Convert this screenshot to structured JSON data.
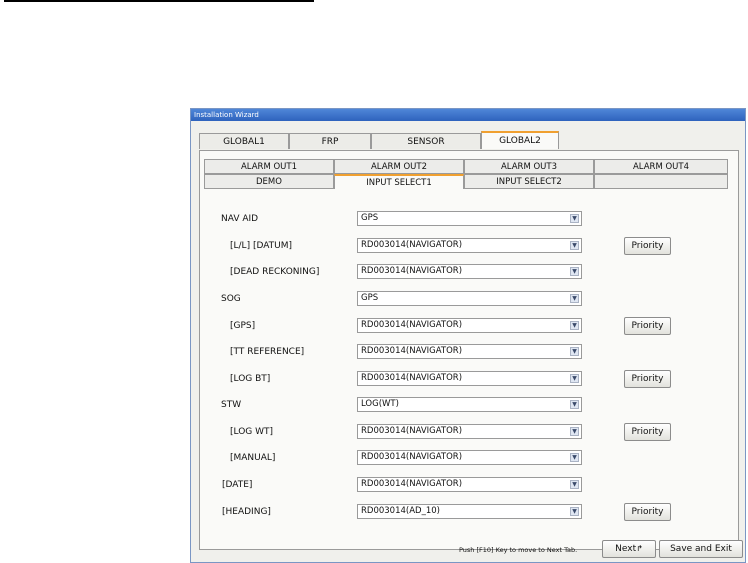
{
  "window": {
    "title": "Installation Wizard"
  },
  "global_tabs": [
    {
      "label": "GLOBAL1",
      "active": false
    },
    {
      "label": "FRP",
      "active": false
    },
    {
      "label": "SENSOR",
      "active": false
    },
    {
      "label": "GLOBAL2",
      "active": true
    }
  ],
  "sub_tabs_row1": [
    {
      "label": "ALARM OUT1",
      "active": false
    },
    {
      "label": "ALARM OUT2",
      "active": false
    },
    {
      "label": "ALARM OUT3",
      "active": false
    },
    {
      "label": "ALARM OUT4",
      "active": false
    }
  ],
  "sub_tabs_row2": [
    {
      "label": "DEMO",
      "active": false
    },
    {
      "label": "INPUT SELECT1",
      "active": true
    },
    {
      "label": "INPUT SELECT2",
      "active": false
    },
    {
      "label": "",
      "active": false
    }
  ],
  "rows": [
    {
      "label": "NAV AID",
      "value": "GPS",
      "priority": false
    },
    {
      "label": "[L/L] [DATUM]",
      "value": "RD003014(NAVIGATOR)",
      "priority": true
    },
    {
      "label": "[DEAD RECKONING]",
      "value": "RD003014(NAVIGATOR)",
      "priority": false
    },
    {
      "label": "SOG",
      "value": "GPS",
      "priority": false
    },
    {
      "label": "[GPS]",
      "value": "RD003014(NAVIGATOR)",
      "priority": true
    },
    {
      "label": "[TT REFERENCE]",
      "value": "RD003014(NAVIGATOR)",
      "priority": false
    },
    {
      "label": "[LOG BT]",
      "value": "RD003014(NAVIGATOR)",
      "priority": true
    },
    {
      "label": "STW",
      "value": "LOG(WT)",
      "priority": false
    },
    {
      "label": "[LOG WT]",
      "value": "RD003014(NAVIGATOR)",
      "priority": true
    },
    {
      "label": "[MANUAL]",
      "value": "RD003014(NAVIGATOR)",
      "priority": false
    },
    {
      "label": "[DATE]",
      "value": "RD003014(NAVIGATOR)",
      "priority": false
    },
    {
      "label": "[HEADING]",
      "value": "RD003014(AD_10)",
      "priority": true
    }
  ],
  "priority_label": "Priority",
  "footer": {
    "note": "Push [F10] Key to move to Next Tab.",
    "next_label": "Next",
    "save_exit_label": "Save and Exit"
  }
}
